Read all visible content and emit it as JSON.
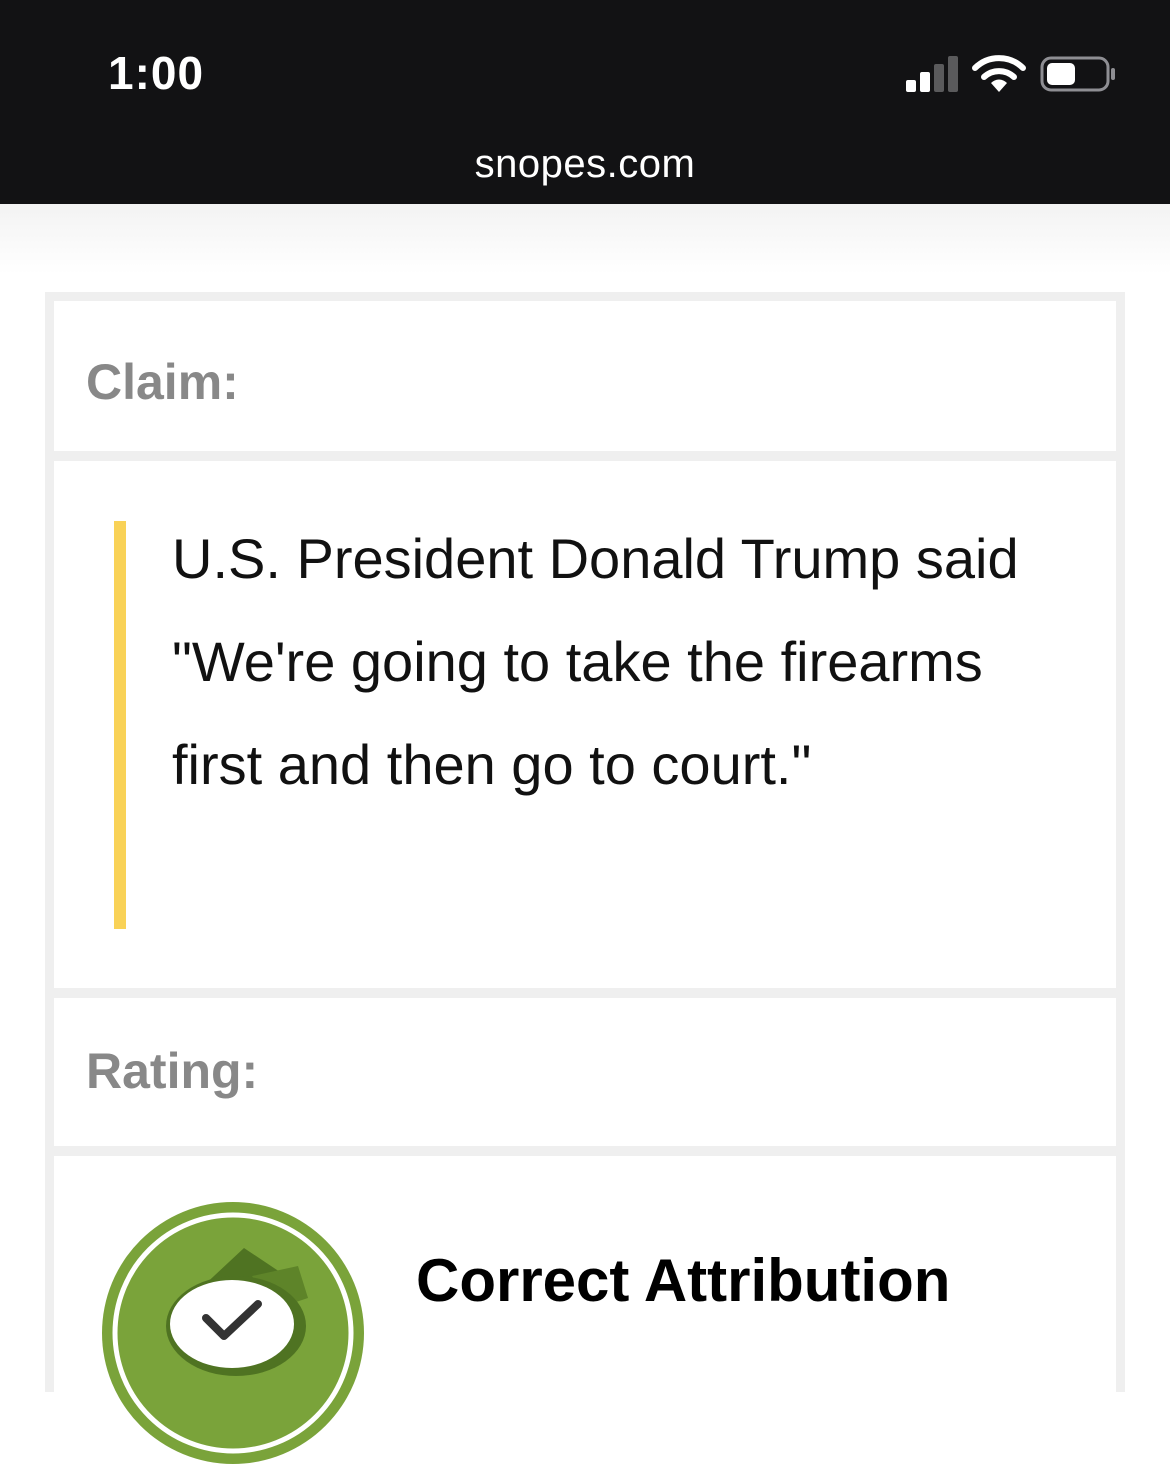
{
  "status_bar": {
    "time": "1:00",
    "url": "snopes.com",
    "icons": [
      "signal-icon",
      "wifi-icon",
      "battery-icon"
    ]
  },
  "fact_check": {
    "claim_label": "Claim:",
    "claim_text": "U.S. President Donald Trump said \"We're going to take the firearms first and then go to court.\"",
    "rating_label": "Rating:",
    "rating_value": "Correct Attribution",
    "rating_icon": "correct-attribution-icon"
  },
  "colors": {
    "status_bar_bg": "#121214",
    "quote_accent": "#f9d257",
    "label_gray": "#888888",
    "rating_green": "#7aa33a",
    "rating_dark_green": "#4f7322"
  }
}
